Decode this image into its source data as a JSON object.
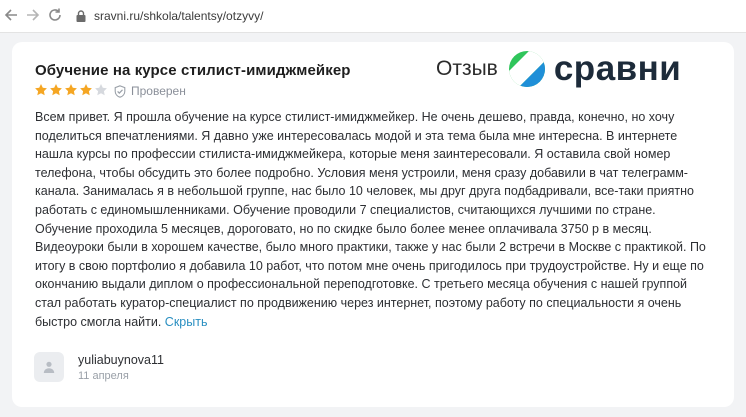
{
  "browser": {
    "url": "sravni.ru/shkola/talentsy/otzyvy/"
  },
  "brand": {
    "label": "Отзыв",
    "name": "сравни",
    "colors": {
      "green": "#2fc55b",
      "blue": "#1f8fd8",
      "dark": "#1d2b3a"
    }
  },
  "review": {
    "title": "Обучение на курсе стилист-имиджмейкер",
    "rating": 4,
    "max_rating": 5,
    "verified_label": "Проверен",
    "text": "Всем привет. Я прошла обучение на курсе стилист-имиджмейкер. Не очень дешево, правда, конечно, но хочу поделиться впечатлениями. Я давно уже интересовалась модой и эта тема была мне интересна. В интернете нашла курсы по профессии стилиста-имиджмейкера, которые меня заинтересовали. Я оставила свой номер телефона, чтобы обсудить это более подробно. Условия меня устроили, меня сразу добавили в чат телеграмм-канала. Занималась я в небольшой группе, нас было 10 человек, мы друг друга подбадривали, все-таки приятно работать с единомышленниками. Обучение проводили 7 специалистов, считающихся лучшими по стране. Обучение проходила 5 месяцев, дороговато, но по скидке было более менее оплачивала 3750 р в месяц. Видеоуроки были в хорошем качестве, было много практики, также у нас были 2 встречи в Москве с практикой. По итогу в свою портфолио я добавила 10 работ, что потом мне очень пригодилось при трудоустройстве. Ну и еще по окончанию выдали диплом о профессиональной переподготовке. С третьего месяца обучения с нашей группой стал работать куратор-специалист по продвижению через интернет, поэтому работу по специальности я очень быстро смогла найти.",
    "collapse_label": "Скрыть",
    "author": "yuliabuynova11",
    "date": "11 апреля"
  },
  "colors": {
    "star_filled": "#f5a623",
    "star_empty": "#d6d9de",
    "link": "#2a8fc1"
  },
  "icons": [
    "back-arrow-icon",
    "forward-arrow-icon",
    "reload-icon",
    "lock-icon",
    "star-icon",
    "shield-check-icon",
    "user-icon",
    "sravni-logo-icon"
  ]
}
